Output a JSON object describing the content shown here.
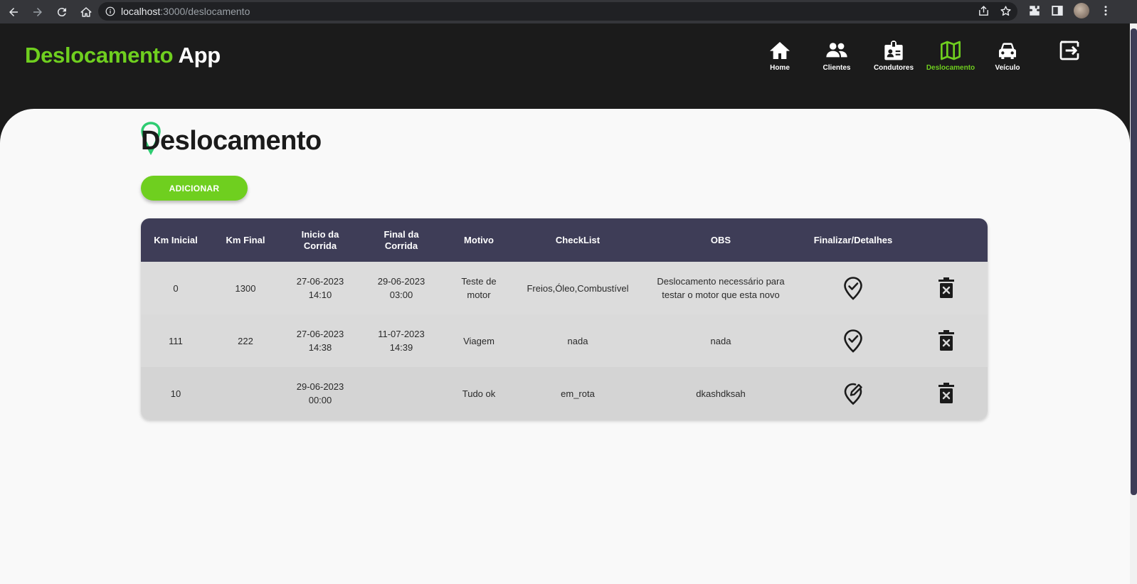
{
  "browser": {
    "url_host": "localhost",
    "url_path": ":3000/deslocamento"
  },
  "header": {
    "brand_part1": "Deslocamento",
    "brand_part2": "App",
    "nav": [
      {
        "label": "Home",
        "icon": "home-icon"
      },
      {
        "label": "Clientes",
        "icon": "users-icon"
      },
      {
        "label": "Condutores",
        "icon": "id-badge-icon"
      },
      {
        "label": "Deslocamento",
        "icon": "map-icon",
        "active": true
      },
      {
        "label": "Veículo",
        "icon": "car-icon"
      },
      {
        "label": "",
        "icon": "logout-icon"
      }
    ]
  },
  "page": {
    "title": "Deslocamento",
    "add_button": "ADICIONAR"
  },
  "table": {
    "headers": {
      "km_inicial": "Km Inicial",
      "km_final": "Km Final",
      "inicio_line1": "Inicio da",
      "inicio_line2": "Corrida",
      "final_line1": "Final da",
      "final_line2": "Corrida",
      "motivo": "Motivo",
      "checklist": "CheckList",
      "obs": "OBS",
      "finalizar": "Finalizar/Detalhes"
    },
    "rows": [
      {
        "km_inicial": "0",
        "km_final": "1300",
        "inicio_date": "27-06-2023",
        "inicio_time": "14:10",
        "final_date": "29-06-2023",
        "final_time": "03:00",
        "motivo_line1": "Teste de",
        "motivo_line2": "motor",
        "checklist": "Freios,Óleo,Combustível",
        "obs_line1": "Deslocamento necessário para",
        "obs_line2": "testar o motor que esta novo",
        "action_icon": "location-check-icon"
      },
      {
        "km_inicial": "111",
        "km_final": "222",
        "inicio_date": "27-06-2023",
        "inicio_time": "14:38",
        "final_date": "11-07-2023",
        "final_time": "14:39",
        "motivo_line1": "Viagem",
        "motivo_line2": "",
        "checklist": "nada",
        "obs_line1": "nada",
        "obs_line2": "",
        "action_icon": "location-check-icon"
      },
      {
        "km_inicial": "10",
        "km_final": "",
        "inicio_date": "29-06-2023",
        "inicio_time": "00:00",
        "final_date": "",
        "final_time": "",
        "motivo_line1": "Tudo ok",
        "motivo_line2": "",
        "checklist": "em_rota",
        "obs_line1": "dkashdksah",
        "obs_line2": "",
        "action_icon": "location-edit-icon"
      }
    ]
  },
  "colors": {
    "accent": "#6fcf1f",
    "header_bg": "#1b1b1b",
    "table_header": "#3e3d57",
    "page_bg": "#f9f9f9"
  }
}
